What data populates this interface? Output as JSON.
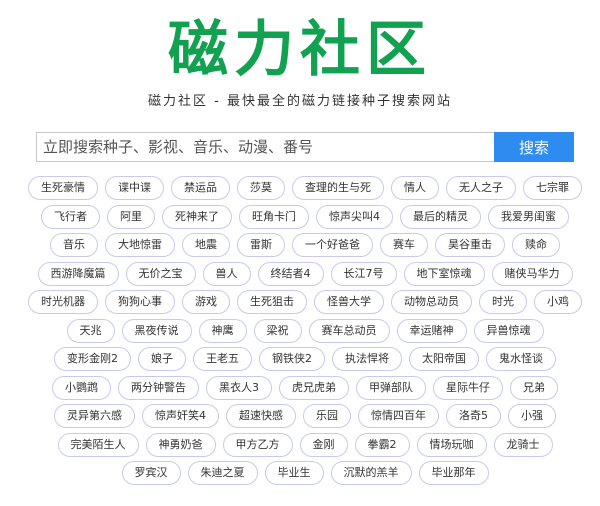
{
  "header": {
    "logo": "磁力社区",
    "tagline": "磁力社区 - 最快最全的磁力链接种子搜索网站"
  },
  "search": {
    "placeholder": "立即搜索种子、影视、音乐、动漫、番号",
    "button_label": "搜索"
  },
  "tag_rows": [
    [
      "生死豪情",
      "谍中谍",
      "禁运品",
      "莎莫",
      "查理的生与死",
      "情人",
      "无人之子",
      "七宗罪"
    ],
    [
      "飞行者",
      "阿里",
      "死神来了",
      "旺角卡门",
      "惊声尖叫4",
      "最后的精灵",
      "我爱男闺蜜"
    ],
    [
      "音乐",
      "大地惊雷",
      "地震",
      "雷斯",
      "一个好爸爸",
      "赛车",
      "昊谷重击",
      "赎命"
    ],
    [
      "西游降魔篇",
      "无价之宝",
      "兽人",
      "终结者4",
      "长江7号",
      "地下室惊魂",
      "赌侠马华力"
    ],
    [
      "时光机器",
      "狗狗心事",
      "游戏",
      "生死狙击",
      "怪兽大学",
      "动物总动员",
      "时光",
      "小鸡"
    ],
    [
      "天兆",
      "黑夜传说",
      "神鹰",
      "梁祝",
      "赛车总动员",
      "幸运赌神",
      "异兽惊魂"
    ],
    [
      "变形金刚2",
      "娘子",
      "王老五",
      "钢铁侠2",
      "执法悍将",
      "太阳帝国",
      "鬼水怪谈"
    ],
    [
      "小鹦鹉",
      "两分钟警告",
      "黑衣人3",
      "虎兄虎弟",
      "甲弹部队",
      "星际牛仔",
      "兄弟"
    ],
    [
      "灵异第六感",
      "惊声奸笑4",
      "超速快感",
      "乐园",
      "惊情四百年",
      "洛奇5",
      "小强"
    ],
    [
      "完美陌生人",
      "神勇奶爸",
      "甲方乙方",
      "金刚",
      "拳霸2",
      "情场玩咖",
      "龙骑士"
    ],
    [
      "罗宾汉",
      "朱迪之夏",
      "毕业生",
      "沉默的羔羊",
      "毕业那年"
    ]
  ]
}
